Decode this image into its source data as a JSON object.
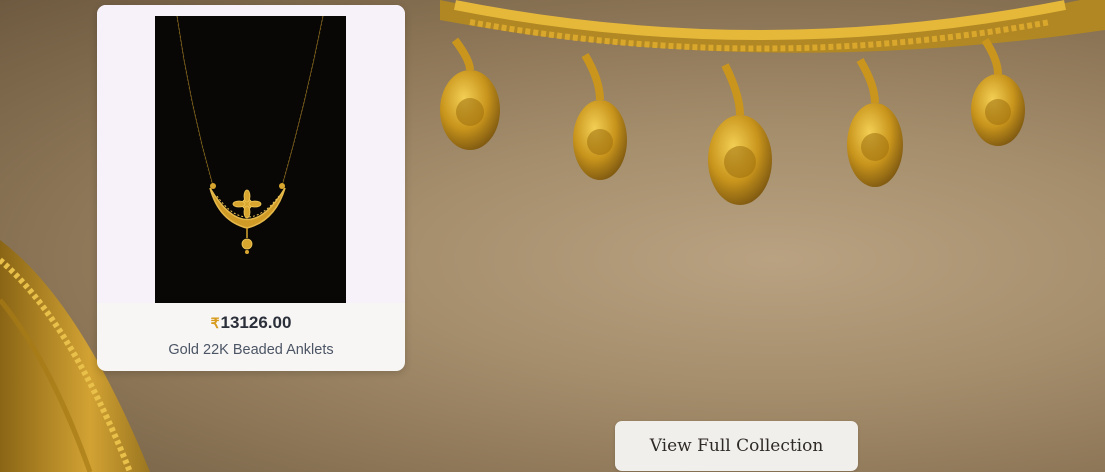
{
  "product": {
    "currency_symbol": "₹",
    "price": "13126.00",
    "name": "Gold 22K Beaded Anklets",
    "image_icon": "gold-pendant-necklace-image"
  },
  "cta": {
    "label": "View Full Collection"
  },
  "colors": {
    "gold": "#d4a12a",
    "currency_accent": "#d89a1c",
    "background_tan": "#a58e6c"
  }
}
